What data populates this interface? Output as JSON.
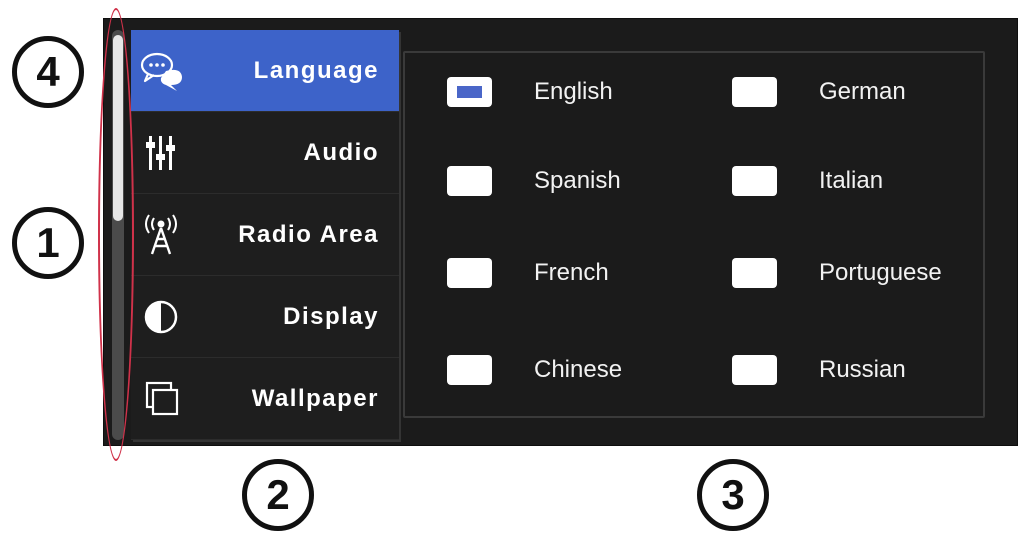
{
  "sidebar": {
    "items": [
      {
        "label": "Language",
        "icon": "language-chat-icon",
        "active": true
      },
      {
        "label": "Audio",
        "icon": "audio-sliders-icon",
        "active": false
      },
      {
        "label": "Radio Area",
        "icon": "radio-tower-icon",
        "active": false
      },
      {
        "label": "Display",
        "icon": "display-contrast-icon",
        "active": false
      },
      {
        "label": "Wallpaper",
        "icon": "wallpaper-layers-icon",
        "active": false
      }
    ],
    "scroll_position": 0.0
  },
  "languages": {
    "options": [
      {
        "label": "English",
        "selected": true
      },
      {
        "label": "Spanish",
        "selected": false
      },
      {
        "label": "French",
        "selected": false
      },
      {
        "label": "Chinese",
        "selected": false
      },
      {
        "label": "German",
        "selected": false
      },
      {
        "label": "Italian",
        "selected": false
      },
      {
        "label": "Portuguese",
        "selected": false
      },
      {
        "label": "Russian",
        "selected": false
      }
    ]
  },
  "callouts": {
    "one": "1",
    "two": "2",
    "three": "3",
    "four": "4"
  },
  "colors": {
    "accent": "#3d63c9",
    "highlight": "#d0324a",
    "background": "#1b1b1b"
  }
}
